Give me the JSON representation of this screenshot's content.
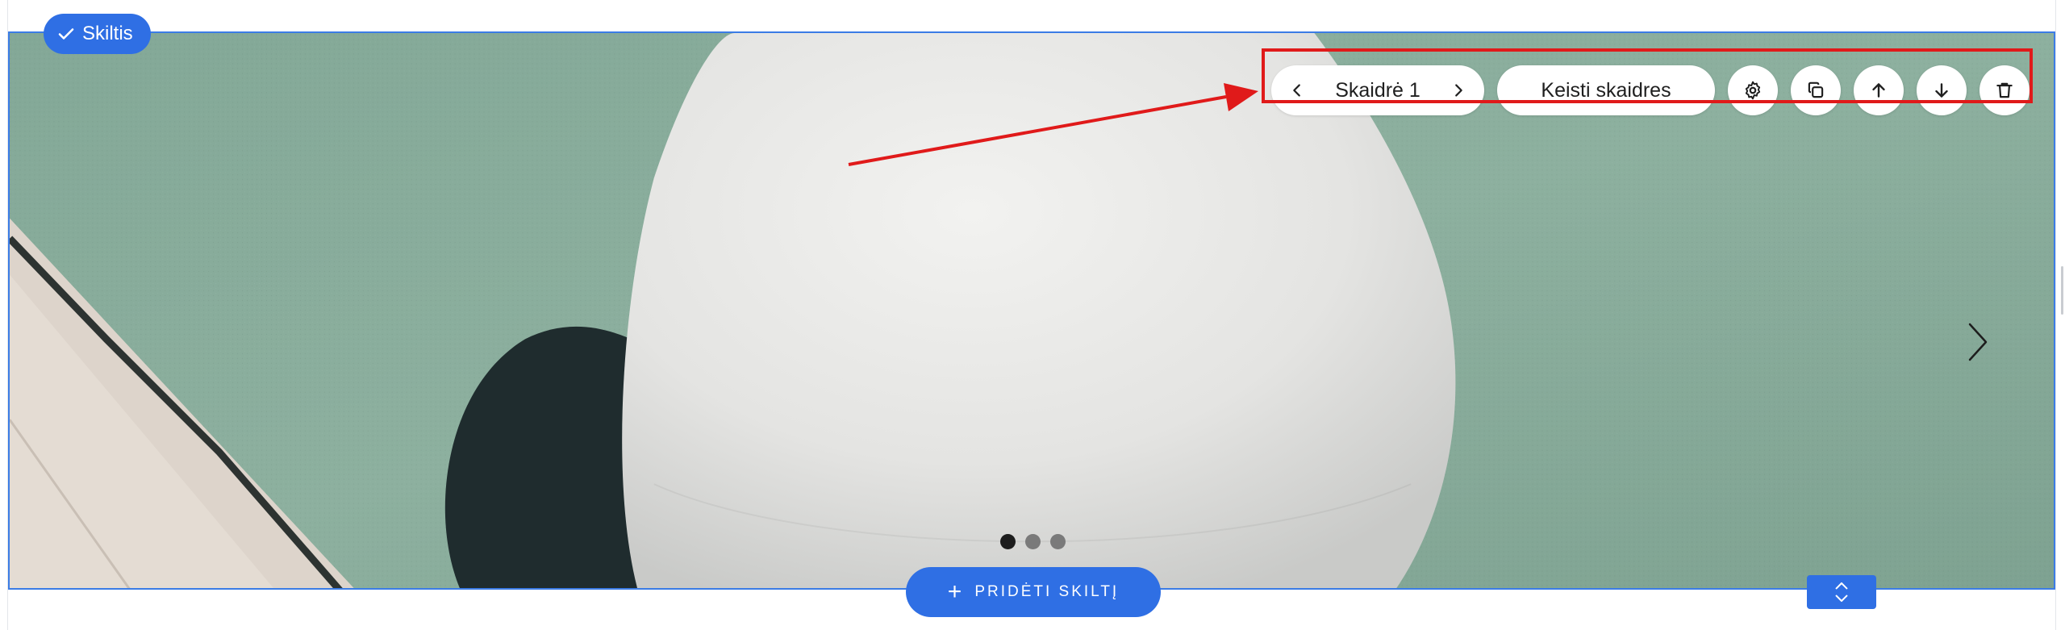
{
  "section": {
    "badge_label": "Skiltis",
    "accent_color": "#2f6fe4"
  },
  "toolbar": {
    "slide_label": "Skaidrė 1",
    "change_slides_label": "Keisti skaidres",
    "icons": [
      "chevron-left-icon",
      "chevron-right-icon",
      "gear-icon",
      "copy-icon",
      "arrow-up-icon",
      "arrow-down-icon",
      "trash-icon"
    ]
  },
  "slideshow": {
    "slide_count": 3,
    "active_slide": 1
  },
  "footer": {
    "add_section_label": "PRIDĖTI SKILTĮ"
  },
  "annotation": {
    "highlight_color": "#e01a1a"
  }
}
